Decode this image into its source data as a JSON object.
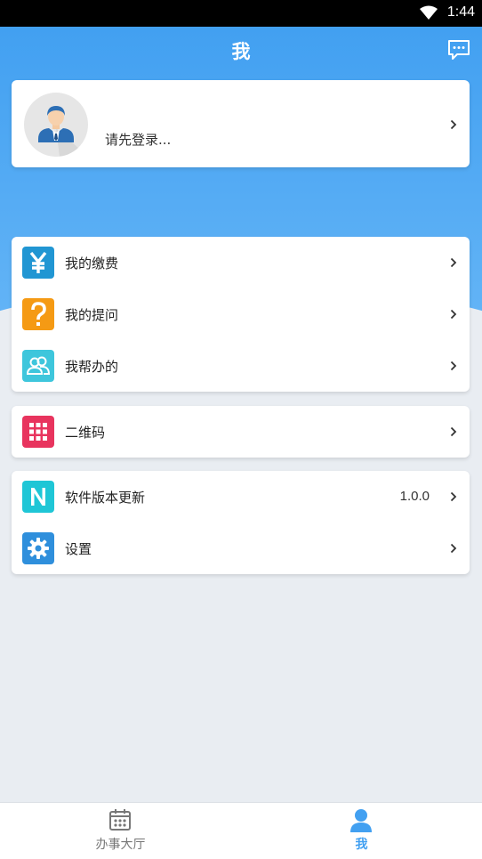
{
  "status_bar": {
    "time": "1:44",
    "wifi_icon": "wifi-icon"
  },
  "header": {
    "title": "我",
    "message_icon": "message-icon",
    "color": "#42a0f1"
  },
  "profile": {
    "login_prompt": "请先登录...",
    "avatar_icon": "user-avatar-icon"
  },
  "menu_groups": [
    {
      "items": [
        {
          "label": "我的缴费",
          "icon": "yen-icon",
          "icon_color": "#2196d3"
        },
        {
          "label": "我的提问",
          "icon": "question-icon",
          "icon_color": "#f59a14"
        },
        {
          "label": "我帮办的",
          "icon": "people-icon",
          "icon_color": "#3ec6dc"
        }
      ]
    },
    {
      "items": [
        {
          "label": "二维码",
          "icon": "grid-icon",
          "icon_color": "#e8345e"
        }
      ]
    },
    {
      "items": [
        {
          "label": "软件版本更新",
          "icon": "n-icon",
          "icon_color": "#1fc6d6",
          "value": "1.0.0"
        },
        {
          "label": "设置",
          "icon": "gear-icon",
          "icon_color": "#2f8fdc"
        }
      ]
    }
  ],
  "icon_glyphs": {
    "yen": "¥",
    "question": "?",
    "n": "N"
  },
  "bottom_nav": {
    "items": [
      {
        "label": "办事大厅",
        "icon": "calendar-icon",
        "active": false,
        "color": "#777777"
      },
      {
        "label": "我",
        "icon": "person-icon",
        "active": true,
        "color": "#42a0f1"
      }
    ]
  }
}
